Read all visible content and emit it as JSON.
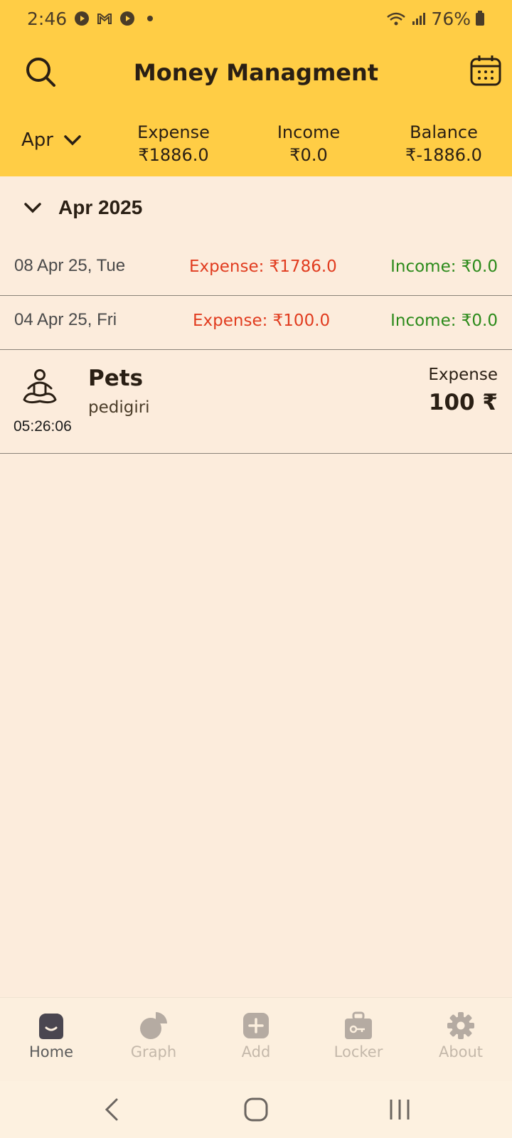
{
  "status_bar": {
    "time": "2:46",
    "battery": "76%"
  },
  "header": {
    "title": "Money Managment"
  },
  "summary": {
    "month": "Apr",
    "expense_label": "Expense",
    "expense_value": "₹1886.0",
    "income_label": "Income",
    "income_value": "₹0.0",
    "balance_label": "Balance",
    "balance_value": "₹-1886.0"
  },
  "group": {
    "label": "Apr 2025"
  },
  "days": [
    {
      "date": "08 Apr 25, Tue",
      "expense": "Expense: ₹1786.0",
      "income": "Income: ₹0.0"
    },
    {
      "date": "04 Apr 25, Fri",
      "expense": "Expense: ₹100.0",
      "income": "Income: ₹0.0"
    }
  ],
  "transaction": {
    "time": "05:26:06",
    "category": "Pets",
    "note": "pedigiri",
    "type": "Expense",
    "amount": "100 ₹"
  },
  "bottom_nav": [
    {
      "label": "Home",
      "icon": "home-icon",
      "active": true
    },
    {
      "label": "Graph",
      "icon": "pie-chart-icon"
    },
    {
      "label": "Add",
      "icon": "add-icon"
    },
    {
      "label": "Locker",
      "icon": "locker-icon"
    },
    {
      "label": "About",
      "icon": "gear-icon"
    }
  ],
  "colors": {
    "primary": "#ffcd45",
    "background": "#fcecdc",
    "expense": "#e13c1f",
    "income": "#2b8a1a"
  }
}
